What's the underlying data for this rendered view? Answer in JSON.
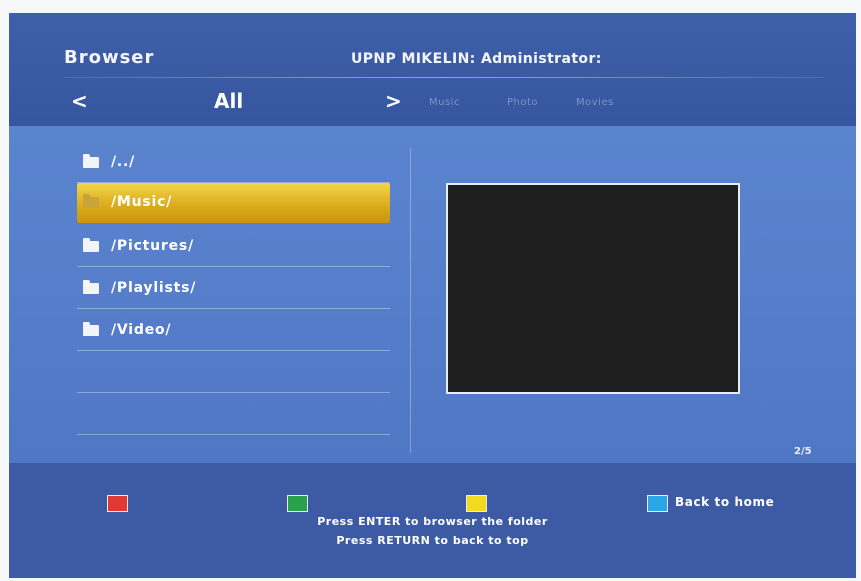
{
  "header": {
    "app_title": "Browser",
    "server_title": "UPNP MIKELIN: Administrator:",
    "nav_prev": "<",
    "nav_next": ">",
    "current_filter": "All",
    "filter_tabs": [
      "Music",
      "Photo",
      "Movies"
    ]
  },
  "file_list": {
    "items": [
      {
        "name": "/../",
        "icon": "folder-icon",
        "selected": false
      },
      {
        "name": "/Music/",
        "icon": "folder-icon",
        "selected": true
      },
      {
        "name": "/Pictures/",
        "icon": "folder-icon",
        "selected": false
      },
      {
        "name": "/Playlists/",
        "icon": "folder-icon",
        "selected": false
      },
      {
        "name": "/Video/",
        "icon": "folder-icon",
        "selected": false
      }
    ],
    "page_counter": "2/5"
  },
  "footer": {
    "color_keys": [
      {
        "color": "#e23a32",
        "label": ""
      },
      {
        "color": "#27a24b",
        "label": ""
      },
      {
        "color": "#f3d91f",
        "label": ""
      },
      {
        "color": "#2aa7e6",
        "label": "Back to home"
      }
    ],
    "hint_enter": "Press ENTER to browser the folder",
    "hint_return": "Press RETURN to back to top"
  },
  "colors": {
    "background": "#3a5ba6",
    "content_background": "#5680ca",
    "selection": "#e0b52a"
  }
}
